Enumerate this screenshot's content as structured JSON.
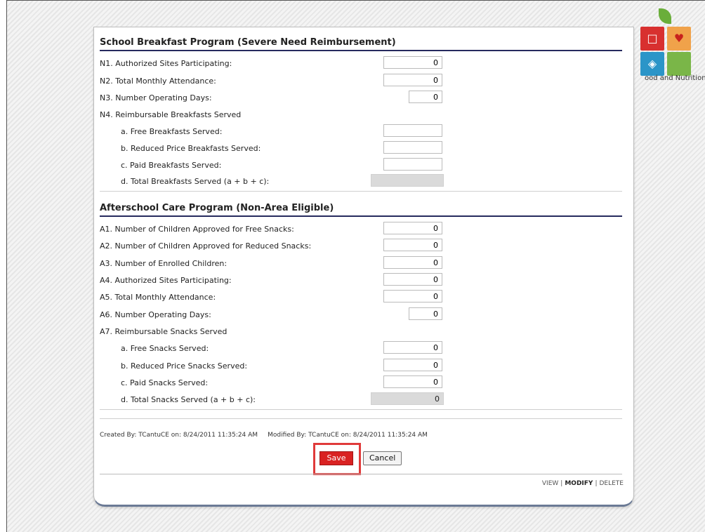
{
  "brand": {
    "tagline": "ood and Nutrition",
    "colors": {
      "red": "#d8302f",
      "orange": "#f0a24a",
      "blue": "#2b95c8",
      "green": "#7ab648",
      "apple": "#6aae3a"
    }
  },
  "breakfast": {
    "title": "School Breakfast Program (Severe Need Reimbursement)",
    "n1": {
      "label": "N1.  Authorized Sites Participating:",
      "value": "0"
    },
    "n2": {
      "label": "N2.  Total Monthly Attendance:",
      "value": "0"
    },
    "n3": {
      "label": "N3.  Number Operating Days:",
      "value": "0"
    },
    "n4": {
      "label": "N4.  Reimbursable Breakfasts Served"
    },
    "a": {
      "label": "a. Free Breakfasts Served:",
      "value": ""
    },
    "b": {
      "label": "b. Reduced Price Breakfasts Served:",
      "value": ""
    },
    "c": {
      "label": "c. Paid Breakfasts Served:",
      "value": ""
    },
    "d": {
      "label": "d. Total Breakfasts Served (a + b + c):",
      "value": ""
    }
  },
  "afterschool": {
    "title": "Afterschool Care Program (Non-Area Eligible)",
    "a1": {
      "label": "A1.  Number of Children Approved for Free Snacks:",
      "value": "0"
    },
    "a2": {
      "label": "A2.  Number of Children Approved for Reduced Snacks:",
      "value": "0"
    },
    "a3": {
      "label": "A3.  Number of Enrolled Children:",
      "value": "0"
    },
    "a4": {
      "label": "A4.  Authorized Sites Participating:",
      "value": "0"
    },
    "a5": {
      "label": "A5.  Total Monthly Attendance:",
      "value": "0"
    },
    "a6": {
      "label": "A6.  Number Operating Days:",
      "value": "0"
    },
    "a7": {
      "label": "A7.  Reimbursable Snacks Served"
    },
    "a": {
      "label": "a. Free Snacks Served:",
      "value": "0"
    },
    "b": {
      "label": "b. Reduced Price Snacks Served:",
      "value": "0"
    },
    "c": {
      "label": "c. Paid Snacks Served:",
      "value": "0"
    },
    "d": {
      "label": "d. Total Snacks Served (a + b + c):",
      "value": "0"
    }
  },
  "audit": {
    "created": "Created By: TCantuCE on: 8/24/2011 11:35:24 AM",
    "modified": "Modified By: TCantuCE on: 8/24/2011 11:35:24 AM"
  },
  "buttons": {
    "save": "Save",
    "cancel": "Cancel"
  },
  "links": {
    "view": "VIEW",
    "modify": "MODIFY",
    "delete": "DELETE",
    "separator": "|"
  }
}
